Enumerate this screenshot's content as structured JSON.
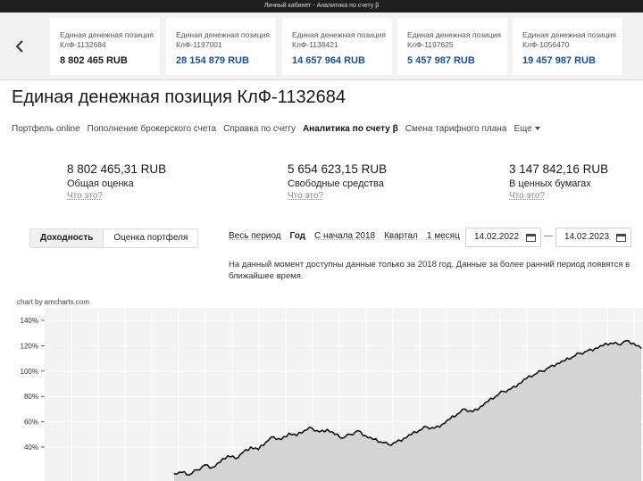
{
  "window_title": "Личный кабинет - Аналитика по счету β",
  "accounts": [
    {
      "name": "Единая денежная позиция",
      "code": "КлФ-1132684",
      "amount": "8 802 465 RUB",
      "active": true
    },
    {
      "name": "Единая денежная позиция",
      "code": "КлФ-1197001",
      "amount": "28 154 879 RUB",
      "active": false
    },
    {
      "name": "Единая денежная позиция",
      "code": "КлФ-1138421",
      "amount": "14 657 964 RUB",
      "active": false
    },
    {
      "name": "Единая денежная позиция",
      "code": "КлФ-1197625",
      "amount": "5 457 987 RUB",
      "active": false
    },
    {
      "name": "Единая денежная позиция",
      "code": "КлФ-1056470",
      "amount": "19 457 987 RUB",
      "active": false
    }
  ],
  "page_title": "Единая денежная позиция КлФ-1132684",
  "nav": [
    {
      "label": "Портфель online",
      "active": false
    },
    {
      "label": "Пополнение брокерского счета",
      "active": false
    },
    {
      "label": "Справка по счету",
      "active": false
    },
    {
      "label": "Аналитика по счету β",
      "active": true
    },
    {
      "label": "Смена тарифного плана",
      "active": false
    },
    {
      "label": "Еще",
      "active": false
    }
  ],
  "stats": [
    {
      "value": "8 802 465,31 RUB",
      "label": "Общая оценка",
      "help": "Что это?"
    },
    {
      "value": "5 654 623,15 RUB",
      "label": "Свободные средства",
      "help": "Что это?"
    },
    {
      "value": "3 147 842,16 RUB",
      "label": "В ценных бумагах",
      "help": "Что это?"
    }
  ],
  "mode_tabs": [
    {
      "label": "Доходность",
      "active": true
    },
    {
      "label": "Оценка портфеля",
      "active": false
    }
  ],
  "periods": [
    {
      "label": "Весь период",
      "active": false
    },
    {
      "label": "Год",
      "active": true
    },
    {
      "label": "С начала 2018",
      "active": false
    },
    {
      "label": "Квартал",
      "active": false
    },
    {
      "label": "1 месяц",
      "active": false
    }
  ],
  "date_from": "14.02.2022",
  "date_to": "14.02.2023",
  "date_separator": "—",
  "notice": "На данный момент доступны данные только за 2018 год. Данные за более ранний период появятся в ближайшее время.",
  "chart_credit": "chart by amcharts.com",
  "chart_data": {
    "type": "area",
    "title": "",
    "xlabel": "",
    "ylabel": "",
    "y_ticks": [
      "140%",
      "120%",
      "100%",
      "80%",
      "60%",
      "40%"
    ],
    "ylim": [
      20,
      140
    ],
    "grid": true,
    "series": [
      {
        "values": [
          19,
          20,
          18,
          22,
          26,
          24,
          28,
          33,
          31,
          36,
          40,
          38,
          44,
          48,
          46,
          51,
          49,
          53,
          55,
          52,
          54,
          50,
          47,
          50,
          53,
          49,
          46,
          44,
          42,
          44,
          47,
          50,
          53,
          56,
          55,
          58,
          62,
          66,
          70,
          68,
          72,
          76,
          80,
          84,
          86,
          90,
          94,
          97,
          100,
          103,
          106,
          108,
          111,
          114,
          116,
          118,
          120,
          122,
          121,
          124,
          122,
          118
        ]
      }
    ],
    "color": "#111111",
    "fill": "#d4d4d4"
  }
}
